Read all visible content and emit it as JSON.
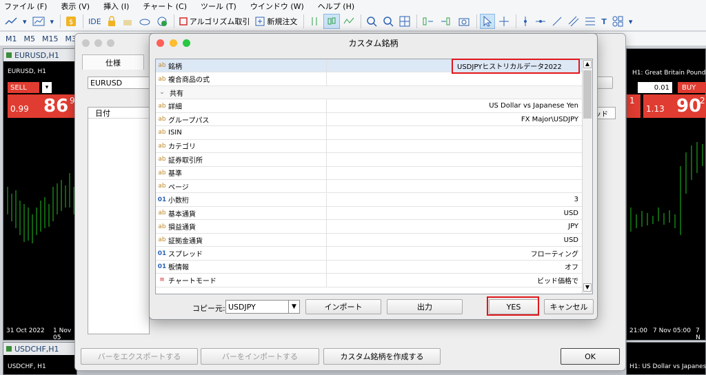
{
  "menu": [
    "ファイル (F)",
    "表示 (V)",
    "挿入 (I)",
    "チャート (C)",
    "ツール (T)",
    "ウインドウ (W)",
    "ヘルプ (H)"
  ],
  "toolbar": {
    "ide": "IDE",
    "algo": "アルゴリズム取引",
    "new_order": "新規注文"
  },
  "timeframes": [
    "M1",
    "M5",
    "M15",
    "M3"
  ],
  "charts": {
    "eurusd_title": "EURUSD,H1",
    "eurusd_inner": "EURUSD, H1",
    "sell_label": "SELL",
    "sell_price_small": "0.99",
    "sell_price_big": "86",
    "sell_price_sup": "9",
    "date1": "31 Oct 2022",
    "date2": "1 Nov 05",
    "usdchf_title": "USDCHF,H1",
    "usdchf_inner": "USDCHF, H1",
    "gbp_inner": "H1: Great Britain Pound vs",
    "lot": "0.01",
    "buy_label": "BUY",
    "buy_price_small": "1.13",
    "buy_price_big": "90",
    "buy_price_sup": "2",
    "right_val": "1",
    "right_time1": "21:00",
    "right_time2": "7 Nov 05:00",
    "right_time3": "7 N",
    "bottom_right_inner": "H1: US Dollar vs Japanese"
  },
  "back_dialog": {
    "tab": "仕様",
    "symbol_value": "EURUSD",
    "col_date": "日付",
    "col_right": "ッド",
    "export_btn": "バーをエクスポートする",
    "import_btn": "バーをインポートする",
    "create_btn": "カスタム銘柄を作成する",
    "ok_btn": "OK"
  },
  "dialog": {
    "title": "カスタム銘柄",
    "rows": [
      {
        "icon": "ab",
        "name": "銘柄",
        "value": "USDJPYヒストリカルデータ2022"
      },
      {
        "icon": "ab",
        "name": "複合商品の式",
        "value": ""
      },
      {
        "icon": "⌄",
        "name": "共有",
        "value": ""
      },
      {
        "icon": "ab",
        "name": "詳細",
        "value": "US Dollar vs Japanese Yen"
      },
      {
        "icon": "ab",
        "name": "グループパス",
        "value": "FX Major\\USDJPY"
      },
      {
        "icon": "ab",
        "name": "ISIN",
        "value": ""
      },
      {
        "icon": "ab",
        "name": "カテゴリ",
        "value": ""
      },
      {
        "icon": "ab",
        "name": "証券取引所",
        "value": ""
      },
      {
        "icon": "ab",
        "name": "基準",
        "value": ""
      },
      {
        "icon": "ab",
        "name": "ページ",
        "value": ""
      },
      {
        "icon": "01",
        "name": "小数桁",
        "value": "3"
      },
      {
        "icon": "ab",
        "name": "基本通貨",
        "value": "USD"
      },
      {
        "icon": "ab",
        "name": "損益通貨",
        "value": "JPY"
      },
      {
        "icon": "ab",
        "name": "証拠金通貨",
        "value": "USD"
      },
      {
        "icon": "01",
        "name": "スプレッド",
        "value": "フローティング"
      },
      {
        "icon": "01",
        "name": "板情報",
        "value": "オフ"
      },
      {
        "icon": "≡",
        "name": "チャートモード",
        "value": "ビッド価格で"
      }
    ],
    "copy_label": "コピー元:",
    "copy_value": "USDJPY",
    "import_btn": "インポート",
    "output_btn": "出力",
    "yes_btn": "YES",
    "cancel_btn": "キャンセル"
  },
  "colors": {
    "sell": "#e03c31",
    "buy": "#e03c31",
    "highlight": "#e0161b",
    "candle": "#22c322"
  }
}
